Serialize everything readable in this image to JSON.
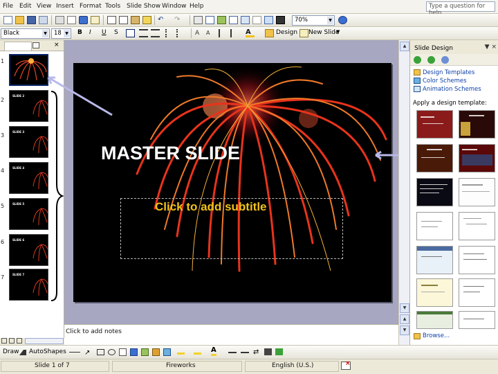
{
  "menu": [
    "File",
    "Edit",
    "View",
    "Insert",
    "Format",
    "Tools",
    "Slide Show",
    "Window",
    "Help"
  ],
  "help_box": {
    "text": "Type a question for help"
  },
  "standard_toolbar": {
    "zoom": "70%"
  },
  "formatting_toolbar": {
    "font": "Black",
    "font_size": "18",
    "bold": "B",
    "italic": "I",
    "underline": "U",
    "shadow": "S",
    "design_label": "Design",
    "new_slide_label": "New Slide"
  },
  "slides_pane": {
    "thumbnails": [
      {
        "number": "1",
        "title": ""
      },
      {
        "number": "2",
        "title": "SLIDE 2"
      },
      {
        "number": "3",
        "title": "SLIDE 3"
      },
      {
        "number": "4",
        "title": "SLIDE 4"
      },
      {
        "number": "5",
        "title": "SLIDE 5"
      },
      {
        "number": "6",
        "title": "SLIDE 6"
      },
      {
        "number": "7",
        "title": "SLIDE 7"
      }
    ]
  },
  "slide": {
    "title": "MASTER SLIDE",
    "subtitle": "Click to add subtitle",
    "subtitle_color": "#f2c21a"
  },
  "notes": {
    "placeholder": "Click to add notes"
  },
  "task_pane": {
    "title": "Slide Design",
    "links": [
      "Design Templates",
      "Color Schemes",
      "Animation Schemes"
    ],
    "apply_label": "Apply a design template:",
    "browse_label": "Browse..."
  },
  "drawing_toolbar": {
    "draw_label": "Draw",
    "autoshapes_label": "AutoShapes"
  },
  "status": {
    "slide_position": "Slide 1 of 7",
    "design_name": "Fireworks",
    "language": "English (U.S.)"
  }
}
